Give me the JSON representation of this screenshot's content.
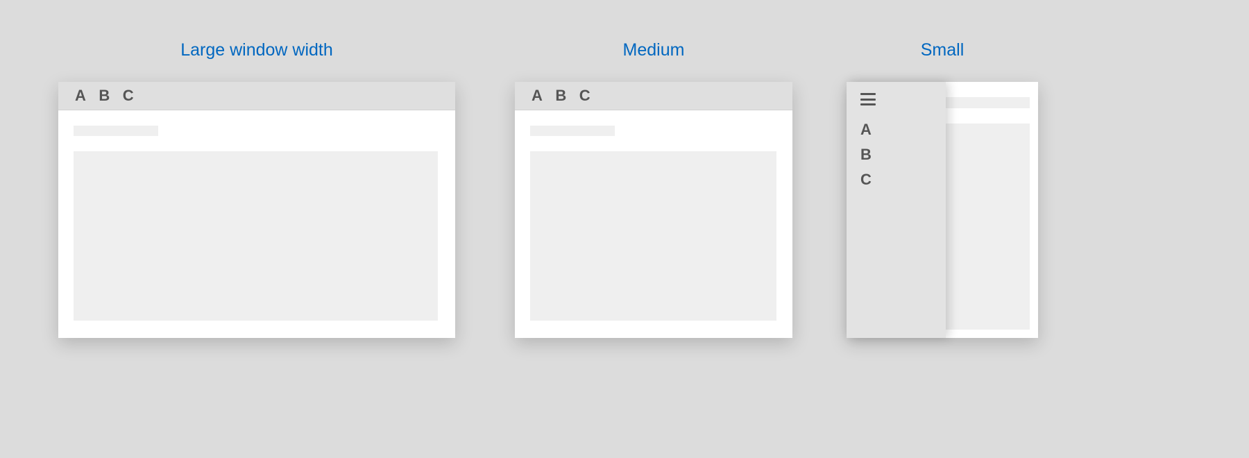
{
  "titles": {
    "large": "Large window width",
    "medium": "Medium",
    "small": "Small"
  },
  "tabs": {
    "a": "A",
    "b": "B",
    "c": "C"
  }
}
